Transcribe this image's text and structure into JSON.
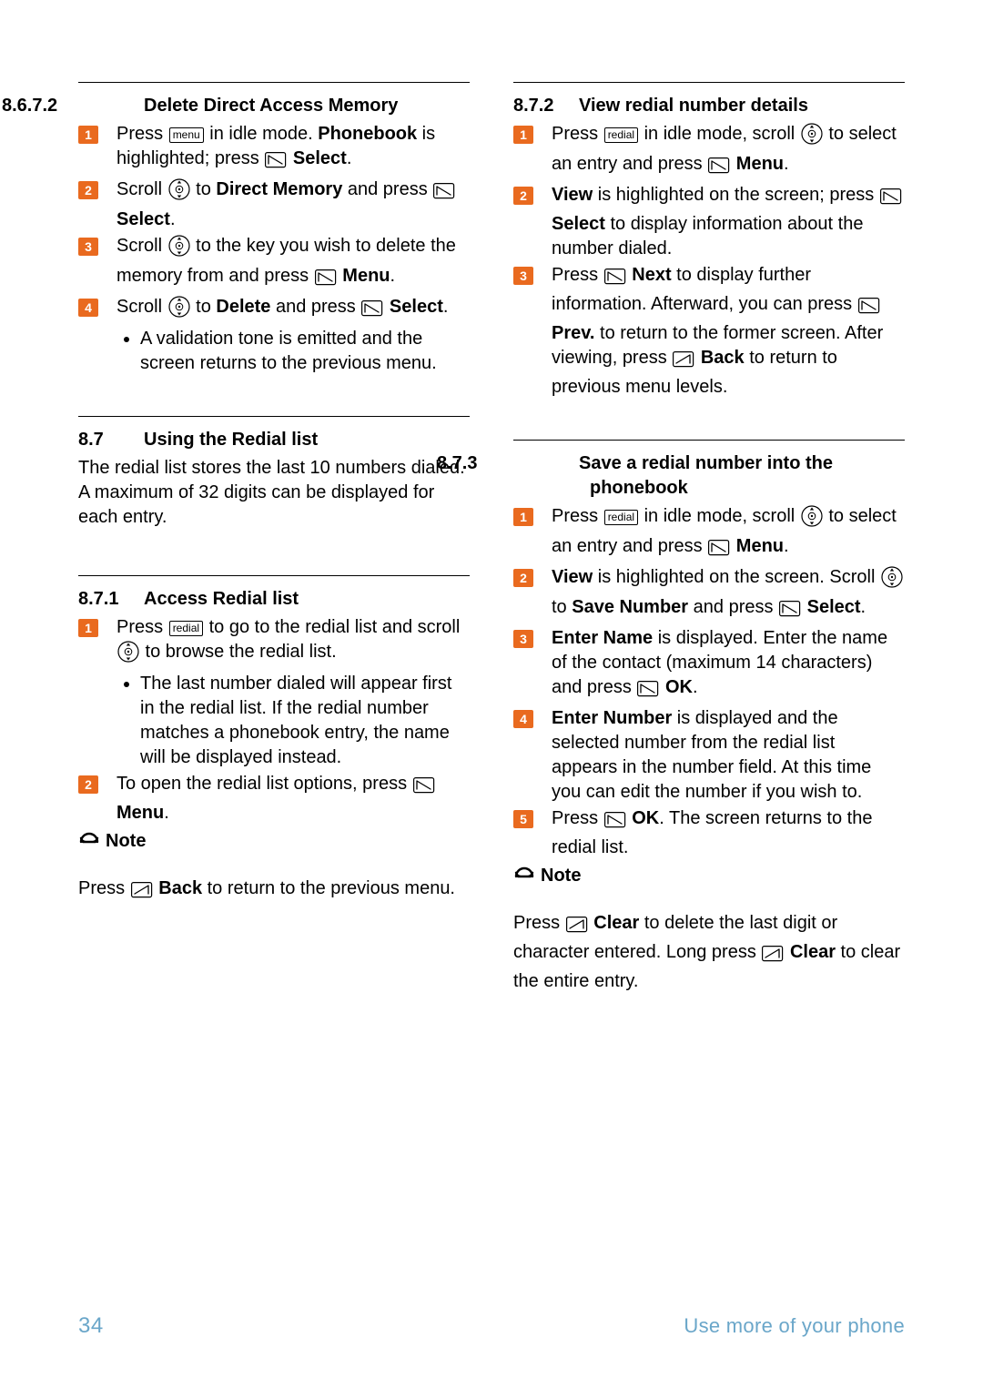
{
  "page": {
    "number": "34",
    "footerTitle": "Use more of your phone"
  },
  "keys": {
    "menu": "menu",
    "redial": "redial"
  },
  "noteLabel": "Note",
  "left": {
    "s1": {
      "num": "8.6.7.2",
      "title": "Delete Direct Access Memory",
      "step1a": "Press ",
      "step1b": " in idle mode. ",
      "step1c": "Phonebook",
      "step1d": " is highlighted; press ",
      "step1e": "Select",
      "step1f": ".",
      "step2a": "Scroll ",
      "step2b": " to ",
      "step2c": "Direct Memory",
      "step2d": " and press ",
      "step2e": "Select",
      "step2f": ".",
      "step3a": "Scroll ",
      "step3b": " to the key you wish to delete the memory from and press ",
      "step3c": "Menu",
      "step3d": ".",
      "step4a": "Scroll ",
      "step4b": " to ",
      "step4c": "Delete",
      "step4d": " and press ",
      "step4e": "Select",
      "step4f": ".",
      "step4NoteA": "A validation tone is emitted and the screen returns to the previous menu."
    },
    "s2": {
      "num": "8.7",
      "title": "Using the Redial list",
      "intro": "The redial list stores the last 10 numbers dialed. A maximum of 32 digits can be displayed for each entry."
    },
    "s3": {
      "num": "8.7.1",
      "title": "Access Redial list",
      "step1a": "Press ",
      "step1b": " to go to the redial list and scroll ",
      "step1c": " to browse the redial list.",
      "step1Sub": "The last number dialed will appear first in the redial list. If the redial number matches a phonebook entry, the name will be displayed instead.",
      "step2a": "To open the redial list options, press ",
      "step2b": "Menu",
      "step2c": ".",
      "noteA": "Press ",
      "noteB": "Back",
      "noteC": " to return to the previous menu."
    }
  },
  "right": {
    "s1": {
      "num": "8.7.2",
      "title": "View redial number details",
      "step1a": "Press ",
      "step1b": " in idle mode, scroll ",
      "step1c": " to select an entry and press ",
      "step1d": "Menu",
      "step1e": ".",
      "step2a": "View",
      "step2b": " is highlighted on the screen; press ",
      "step2c": "Select",
      "step2d": " to display information about the number dialed.",
      "step3a": "Press ",
      "step3b": "Next",
      "step3c": " to display further information. Afterward, you can press ",
      "step3d": "Prev.",
      "step3e": " to return to the former screen. After viewing, press ",
      "step3f": "Back",
      "step3g": " to return to previous menu levels."
    },
    "s2": {
      "num": "8.7.3",
      "title": "Save a redial number into the phonebook",
      "step1a": "Press ",
      "step1b": " in idle mode, scroll ",
      "step1c": " to select an entry and press ",
      "step1d": "Menu",
      "step1e": ".",
      "step2a": "View",
      "step2b": " is highlighted on the screen. Scroll ",
      "step2c": " to ",
      "step2d": "Save Number",
      "step2e": " and press ",
      "step2f": "Select",
      "step2g": ".",
      "step3a": "Enter Name",
      "step3b": " is displayed. Enter the name of the contact (maximum 14 characters) and press ",
      "step3c": "OK",
      "step3d": ".",
      "step4a": "Enter Number",
      "step4b": " is displayed and the selected number from the redial list appears in the number field. At this time you can edit the number if you wish to.",
      "step5a": "Press ",
      "step5b": "OK",
      "step5c": ". The screen returns to the redial list.",
      "noteA": "Press ",
      "noteB": "Clear",
      "noteC": " to delete the last digit or character entered. Long press ",
      "noteD": "Clear",
      "noteE": " to clear the entire entry."
    }
  }
}
